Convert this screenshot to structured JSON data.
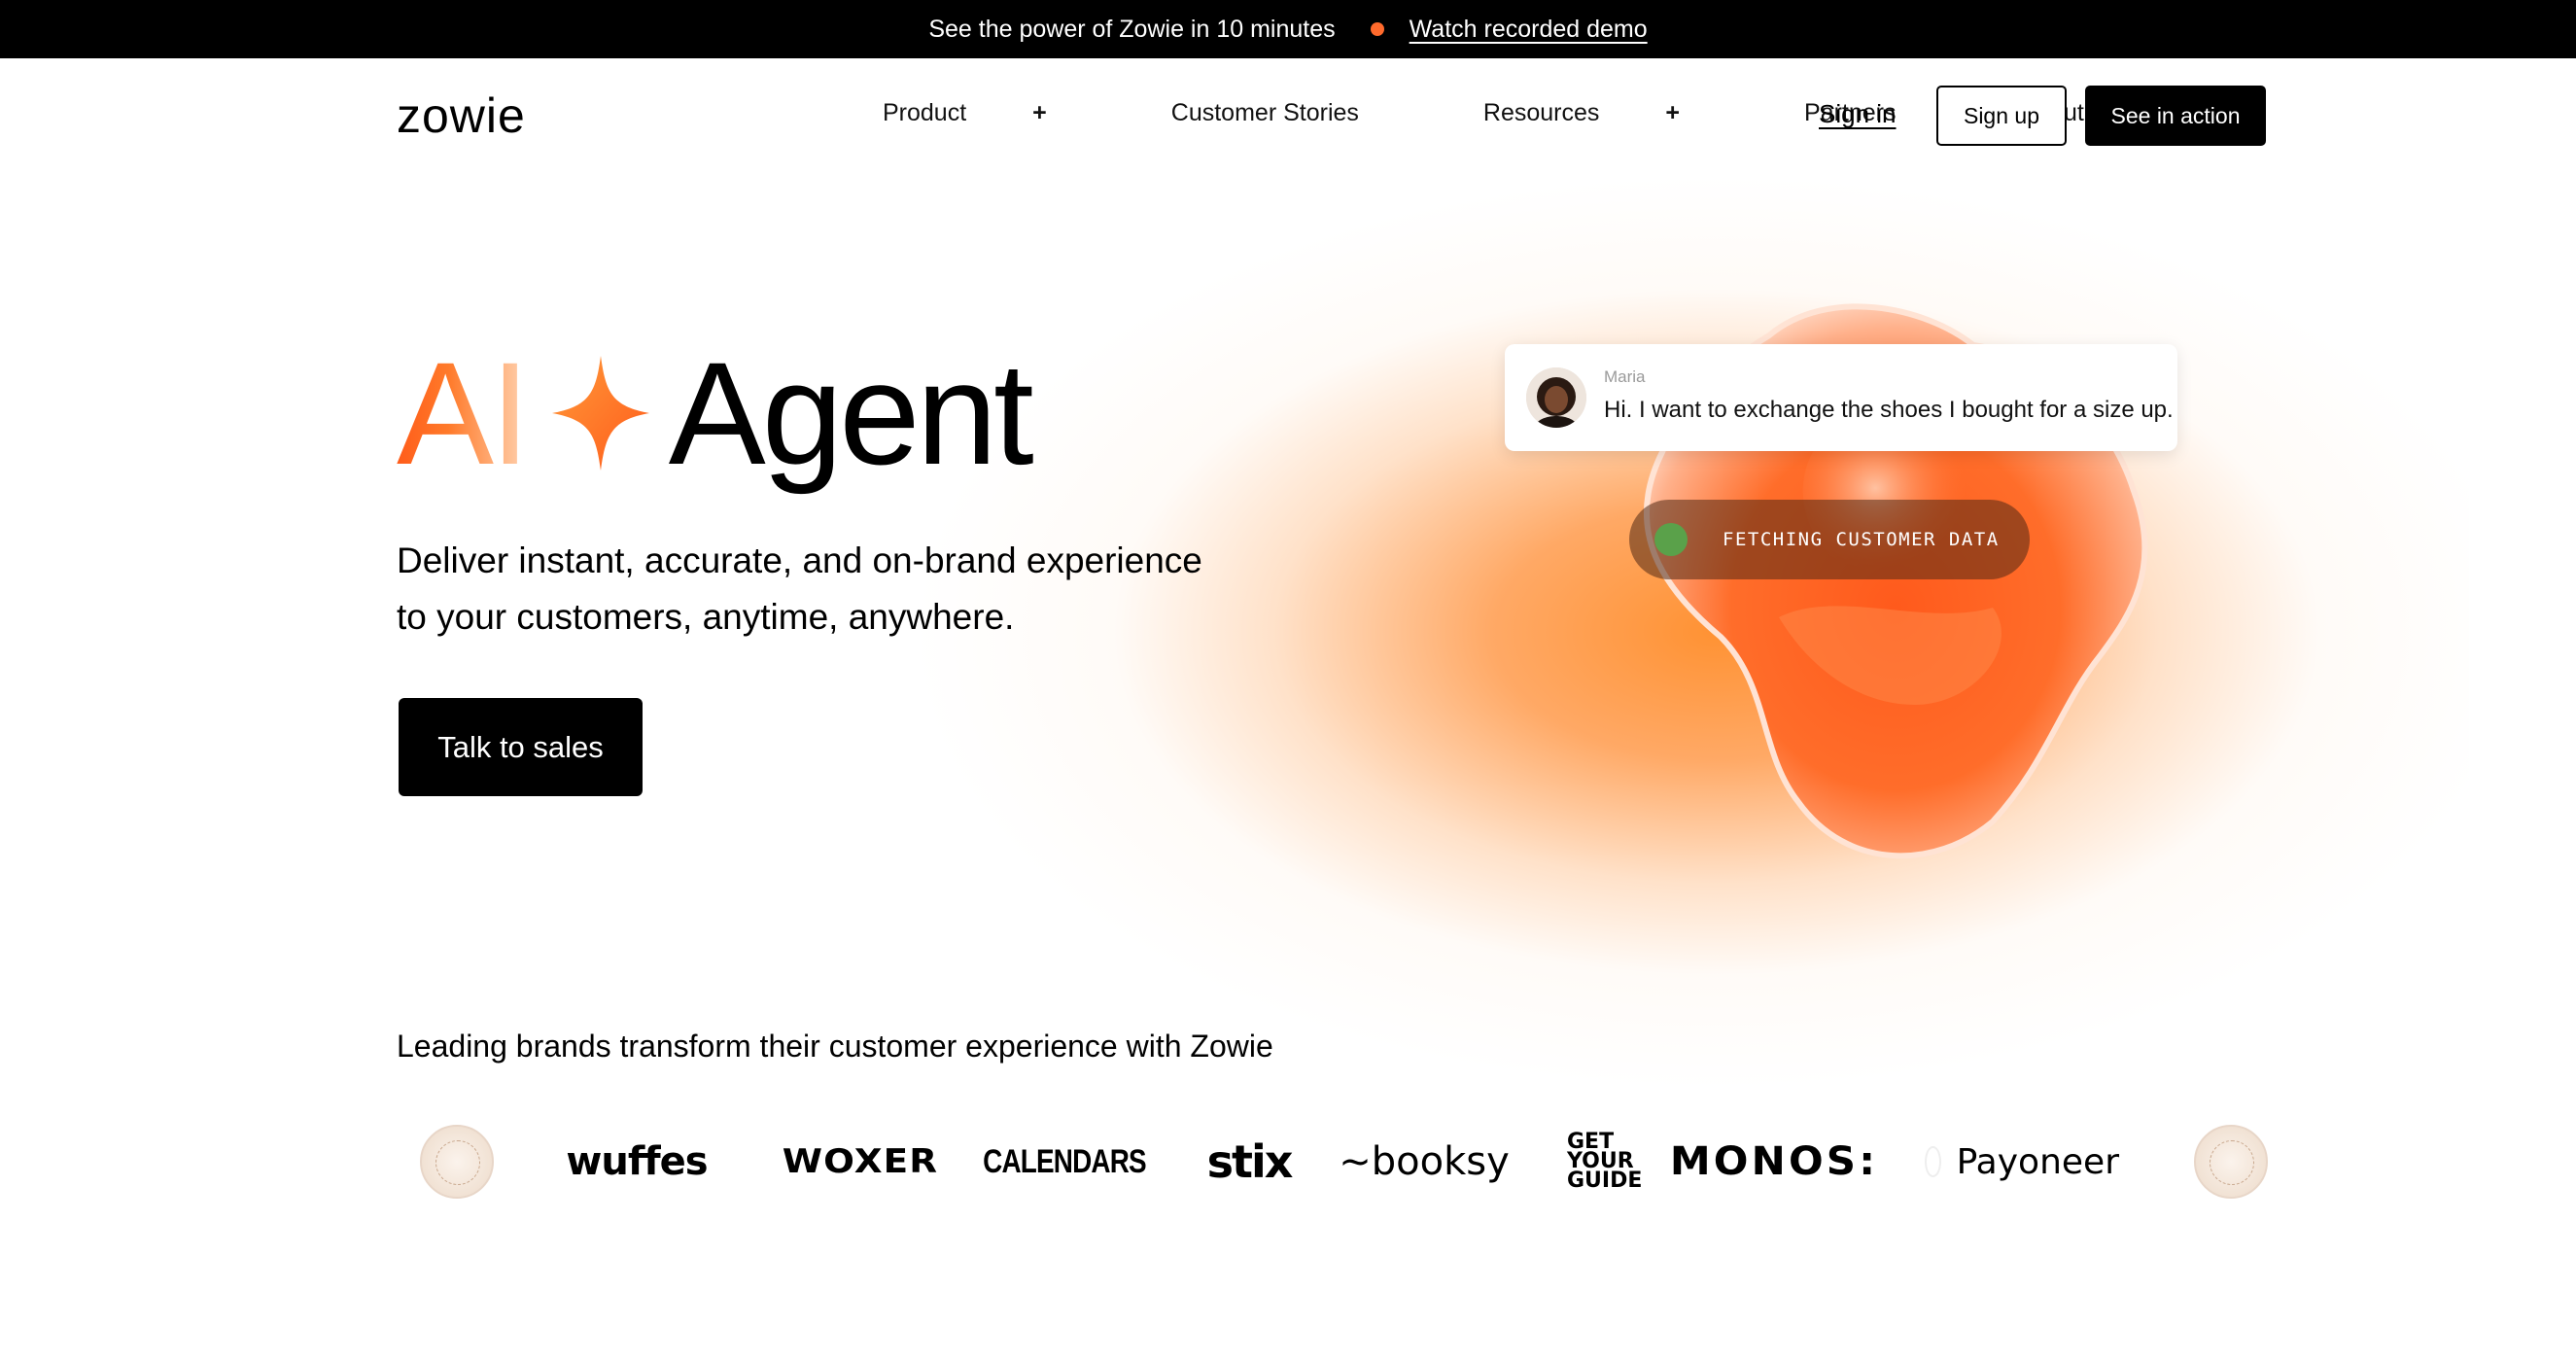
{
  "announcement": {
    "text": "See the power of Zowie in 10 minutes",
    "link": "Watch recorded demo",
    "dot_color": "#ff6a2c"
  },
  "nav": {
    "logo": "zowie",
    "items": [
      {
        "label": "Product",
        "expand": "+"
      },
      {
        "label": "Customer Stories",
        "expand": ""
      },
      {
        "label": "Resources",
        "expand": "+"
      },
      {
        "label": "Partners",
        "expand": ""
      },
      {
        "label": "About us",
        "expand": ""
      }
    ],
    "sign_in": "Sign in",
    "sign_up": "Sign up",
    "see_in_action": "See in action"
  },
  "hero": {
    "title_ai": "AI",
    "title_agent": "Agent",
    "subtitle_line1": "Deliver instant, accurate, and on-brand experience",
    "subtitle_line2": "to your customers, anytime, anywhere.",
    "cta": "Talk to sales",
    "accent_color": "#ff6a2c"
  },
  "chat": {
    "name": "Maria",
    "message": "Hi. I want to exchange the shoes I bought for a size up.",
    "status": "FETCHING CUSTOMER DATA",
    "status_dot_color": "#5aa14a"
  },
  "brands": {
    "title": "Leading brands transform their customer experience with Zowie",
    "logos": [
      {
        "name": "seal-badge",
        "text": ""
      },
      {
        "name": "wuffes",
        "text": "wuffes"
      },
      {
        "name": "woxer",
        "text": "WOXER"
      },
      {
        "name": "calendars",
        "text": "CALENDARS"
      },
      {
        "name": "stix",
        "text": "stix"
      },
      {
        "name": "booksy",
        "text": "booksy"
      },
      {
        "name": "getyourguide",
        "lines": [
          "GET",
          "YOUR",
          "GUIDE"
        ]
      },
      {
        "name": "monos",
        "text": "MONOS:"
      },
      {
        "name": "payoneer",
        "text": "Payoneer"
      },
      {
        "name": "seal-badge-2",
        "text": ""
      }
    ]
  }
}
